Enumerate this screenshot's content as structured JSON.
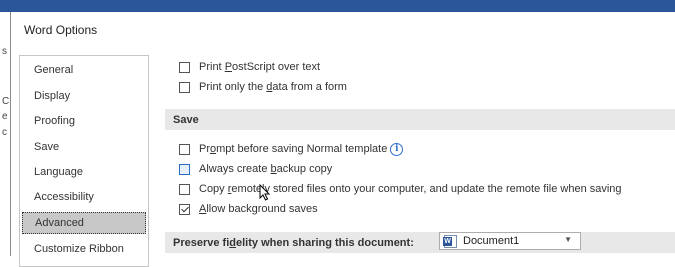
{
  "window": {
    "title": "Word Options"
  },
  "background_letters": [
    "s",
    "C",
    "e",
    "c"
  ],
  "nav": {
    "items": [
      {
        "label": "General",
        "active": false
      },
      {
        "label": "Display",
        "active": false
      },
      {
        "label": "Proofing",
        "active": false
      },
      {
        "label": "Save",
        "active": false
      },
      {
        "label": "Language",
        "active": false
      },
      {
        "label": "Accessibility",
        "active": false
      },
      {
        "label": "Advanced",
        "active": true
      },
      {
        "label": "Customize Ribbon",
        "active": false
      }
    ]
  },
  "print_options": {
    "postscript": {
      "pre": "Print ",
      "u": "P",
      "post": "ostScript over text",
      "checked": false
    },
    "form_data": {
      "pre": "Print only the ",
      "u": "d",
      "post": "ata from a form",
      "checked": false
    }
  },
  "save_section": {
    "header": "Save",
    "prompt_normal": {
      "pre": "Pr",
      "u": "o",
      "post": "mpt before saving Normal template",
      "checked": false,
      "info_icon": "info-icon"
    },
    "backup_copy": {
      "pre": "Always create ",
      "u": "b",
      "post": "ackup copy",
      "checked": false
    },
    "copy_remote": {
      "pre": "Copy ",
      "u": "r",
      "post": "emotely stored files onto your computer, and update the remote file when saving",
      "checked": false
    },
    "background_saves": {
      "pre": "",
      "u": "A",
      "post": "llow background saves",
      "checked": true
    }
  },
  "fidelity": {
    "pre": "Preserve fi",
    "u": "d",
    "post": "elity when sharing this document:",
    "document": "Document1"
  },
  "colors": {
    "accent": "#2b579a",
    "section_bg": "#e8e8e8",
    "nav_active": "#c8c8c8"
  }
}
